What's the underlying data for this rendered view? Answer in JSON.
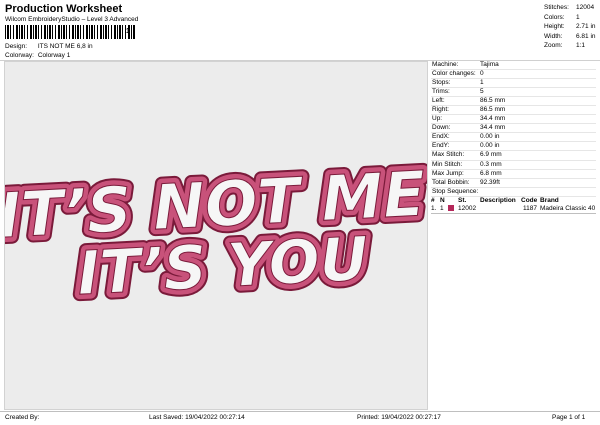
{
  "header": {
    "title": "Production Worksheet",
    "subtitle": "Wilcom EmbroideryStudio – Level 3 Advanced",
    "barcode_mark": "1",
    "design_label": "Design:",
    "design_value": "ITS NOT ME 6,8 in",
    "colorway_label": "Colorway:",
    "colorway_value": "Colorway 1"
  },
  "summary": {
    "stitches_label": "Stitches:",
    "stitches_value": "12004",
    "colors_label": "Colors:",
    "colors_value": "1",
    "height_label": "Height:",
    "height_value": "2.71 in",
    "width_label": "Width:",
    "width_value": "6.81 in",
    "zoom_label": "Zoom:",
    "zoom_value": "1:1"
  },
  "design": {
    "line1": "IT’S NOT ME",
    "line2": "IT’S YOU",
    "fill_color": "#c8527a",
    "outline_color": "#7a1a3a"
  },
  "info": {
    "machine_label": "Machine:",
    "machine_value": "Tajima",
    "color_changes_label": "Color changes:",
    "color_changes_value": "0",
    "stops_label": "Stops:",
    "stops_value": "1",
    "trims_label": "Trims:",
    "trims_value": "5",
    "left_label": "Left:",
    "left_value": "86.5 mm",
    "right_label": "Right:",
    "right_value": "86.5 mm",
    "up_label": "Up:",
    "up_value": "34.4 mm",
    "down_label": "Down:",
    "down_value": "34.4 mm",
    "endx_label": "EndX:",
    "endx_value": "0.00 in",
    "endy_label": "EndY:",
    "endy_value": "0.00 in",
    "max_stitch_label": "Max Stitch:",
    "max_stitch_value": "6.9 mm",
    "min_stitch_label": "Min Stitch:",
    "min_stitch_value": "0.3 mm",
    "max_jump_label": "Max Jump:",
    "max_jump_value": "6.8 mm",
    "total_bobbin_label": "Total Bobbin:",
    "total_bobbin_value": "92.39ft",
    "stop_sequence_label": "Stop Sequence:"
  },
  "sequence": {
    "headers": [
      "#",
      "N",
      "",
      "St.",
      "Description",
      "Code",
      "Brand"
    ],
    "row": {
      "num": "1.",
      "n": "1",
      "swatch_color": "#b5285a",
      "stitches": "12002",
      "description": "",
      "code": "1187",
      "brand": "Madeira Classic 40"
    }
  },
  "footer": {
    "created_by": "Created By:",
    "last_saved": "Last Saved: 19/04/2022 00:27:14",
    "printed": "Printed: 19/04/2022 00:27:17",
    "page": "Page 1 of 1"
  }
}
